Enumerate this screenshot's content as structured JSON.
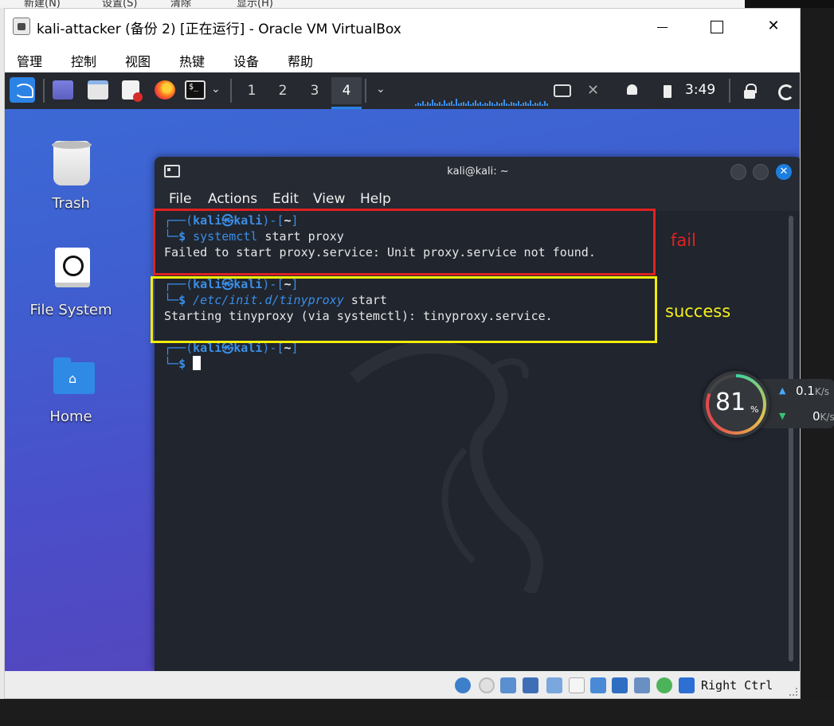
{
  "host": {
    "menu_items": [
      "新建(N)",
      "设置(S)",
      "清除",
      "显示(H)"
    ]
  },
  "window": {
    "title": "kali-attacker (备份 2) [正在运行] - Oracle VM VirtualBox",
    "close_glyph": "✕"
  },
  "vbox_menu": [
    "管理",
    "控制",
    "视图",
    "热键",
    "设备",
    "帮助"
  ],
  "panel": {
    "workspaces": [
      "1",
      "2",
      "3",
      "4"
    ],
    "active_workspace": "4",
    "clock": "3:49",
    "chevron": "⌄",
    "terminal_icon_text": "$_"
  },
  "desktop_icons": [
    {
      "label": "Trash",
      "icon": "trash-icon"
    },
    {
      "label": "File System",
      "icon": "drive-icon"
    },
    {
      "label": "Home",
      "icon": "home-folder-icon"
    }
  ],
  "terminal": {
    "title": "kali@kali: ~",
    "menu": [
      "File",
      "Actions",
      "Edit",
      "View",
      "Help"
    ],
    "close_glyph": "✕",
    "prompt": {
      "top_open": "┌──(",
      "user": "kali",
      "at": "㉿",
      "host": "kali",
      "mid": ")-[",
      "dir": "~",
      "top_close": "]",
      "bottom": "└─",
      "dollar": "$"
    },
    "blocks": [
      {
        "cmd_bin": "systemctl",
        "cmd_args": " start proxy",
        "output": "Failed to start proxy.service: Unit proxy.service not found."
      },
      {
        "cmd_bin": "/etc/init.d/tinyproxy",
        "cmd_args": " start",
        "output": "Starting tinyproxy (via systemctl): tinyproxy.service."
      }
    ]
  },
  "annotations": {
    "fail_label": "fail",
    "success_label": "success",
    "fail_color": "#e02121",
    "success_color": "#f2ec0a"
  },
  "net_widget": {
    "usage": "81",
    "usage_unit": "%",
    "up_value": "0.1",
    "up_unit": "K/s",
    "down_value": "0",
    "down_unit": "K/s",
    "up_arrow": "▲",
    "down_arrow": "▼"
  },
  "statusbar": {
    "host_key": "Right Ctrl"
  }
}
